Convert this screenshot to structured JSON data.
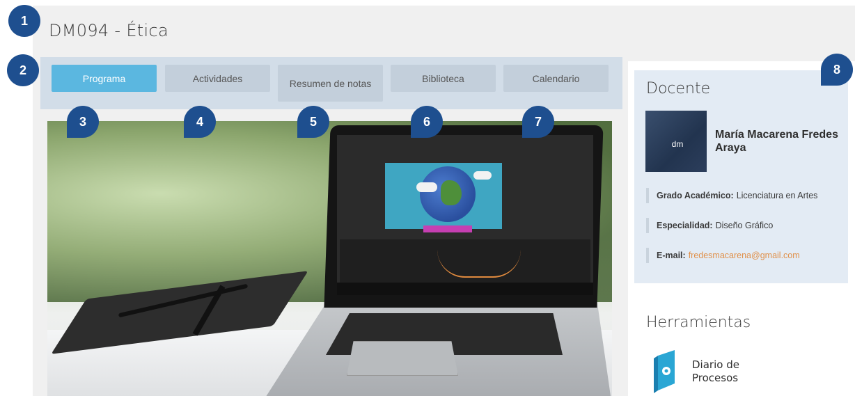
{
  "page": {
    "title": "DM094 - Ética"
  },
  "tabs": [
    {
      "label": "Programa",
      "active": true
    },
    {
      "label": "Actividades",
      "active": false
    },
    {
      "label": "Resumen de notas",
      "active": false
    },
    {
      "label": "Biblioteca",
      "active": false
    },
    {
      "label": "Calendario",
      "active": false
    }
  ],
  "badges": [
    "1",
    "2",
    "3",
    "4",
    "5",
    "6",
    "7",
    "8"
  ],
  "docente": {
    "heading": "Docente",
    "avatar_initials": "dm",
    "name": "María Macarena Fredes Araya",
    "grado_label": "Grado Académico:",
    "grado_value": "Licenciatura en Artes",
    "especialidad_label": "Especialidad:",
    "especialidad_value": "Diseño Gráfico",
    "email_label": "E-mail:",
    "email_value": "fredesmacarena@gmail.com"
  },
  "herramientas": {
    "heading": "Herramientas",
    "tool_label": "Diario de Procesos",
    "tool_icon": "diario-procesos-icon"
  },
  "colors": {
    "active_tab": "#5bb7e0",
    "badge": "#1e4f8f",
    "link": "#e0904a",
    "card": "#e3ebf4"
  }
}
